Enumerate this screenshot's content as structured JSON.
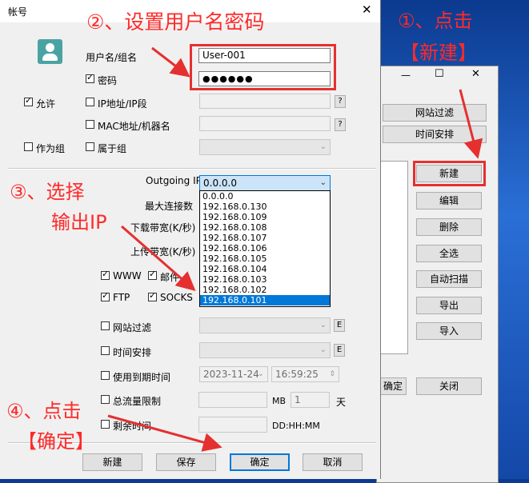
{
  "dialog": {
    "title": "帐号",
    "close_glyph": "✕",
    "user_label": "用户名/组名",
    "user_value": "User-001",
    "password_label": "密码",
    "password_value": "●●●●●●",
    "allow_label": "允许",
    "ip_label": "IP地址/IP段",
    "mac_label": "MAC地址/机器名",
    "as_group_label": "作为组",
    "member_of_label": "属于组",
    "help_glyph": "?",
    "outgoing_ip_label": "Outgoing IP",
    "outgoing_ip_value": "0.0.0.0",
    "outgoing_options": [
      "0.0.0.0",
      "192.168.0.130",
      "192.168.0.109",
      "192.168.0.108",
      "192.168.0.107",
      "192.168.0.106",
      "192.168.0.105",
      "192.168.0.104",
      "192.168.0.103",
      "192.168.0.102",
      "192.168.0.101"
    ],
    "max_conn_label": "最大连接数",
    "download_label": "下载带宽(K/秒)",
    "upload_label": "上传带宽(K/秒)",
    "www_label": "WWW",
    "mail_label": "邮件",
    "ftp_label": "FTP",
    "socks_label": "SOCKS",
    "site_filter_label": "网站过滤",
    "schedule_label": "时间安排",
    "e_glyph": "E",
    "expire_label": "使用到期时间",
    "expire_date": "2023-11-24",
    "expire_time": "16:59:25",
    "traffic_label": "总流量限制",
    "traffic_unit": "MB",
    "traffic_days": "1",
    "days_unit": "天",
    "remaining_label": "剩余时间",
    "remaining_format": "DD:HH:MM",
    "buttons": {
      "new": "新建",
      "save": "保存",
      "ok": "确定",
      "cancel": "取消"
    }
  },
  "background_window": {
    "min_glyph": "—",
    "max_glyph": "☐",
    "close_glyph": "✕",
    "tab_site_filter": "网站过滤",
    "tab_schedule": "时间安排",
    "buttons": [
      "新建",
      "编辑",
      "删除",
      "全选",
      "自动扫描",
      "导出",
      "导入"
    ],
    "ok_label": "确定",
    "close_label": "关闭"
  },
  "annotations": {
    "step1": "①、点击",
    "step1b": "【新建】",
    "step2": "②、设置用户名密码",
    "step3": "③、选择",
    "step3b": "输出IP",
    "step4": "④、点击",
    "step4b": "【确定】"
  },
  "colors": {
    "annotation_red": "#ff2a2a",
    "accent_blue": "#0078d7",
    "avatar_teal": "#4aa3a3"
  }
}
